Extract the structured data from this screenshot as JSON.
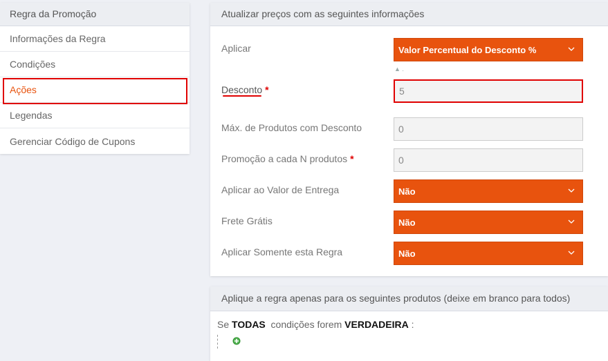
{
  "sidebar": {
    "title": "Regra da Promoção",
    "items": [
      {
        "label": "Informações da Regra",
        "active": false
      },
      {
        "label": "Condições",
        "active": false
      },
      {
        "label": "Ações",
        "active": true
      },
      {
        "label": "Legendas",
        "active": false
      },
      {
        "label": "Gerenciar Código de Cupons",
        "active": false
      }
    ]
  },
  "main": {
    "title": "Atualizar preços com as seguintes informações",
    "fields": {
      "aplicar": {
        "label": "Aplicar",
        "value": "Valor Percentual do Desconto %",
        "note": "▲ ."
      },
      "desconto": {
        "label": "Desconto",
        "required": "*",
        "value": "5"
      },
      "max_produtos": {
        "label": "Máx. de Produtos com Desconto",
        "value": "0"
      },
      "promocao_n": {
        "label": "Promoção a cada N produtos",
        "required": "*",
        "value": "0"
      },
      "valor_entrega": {
        "label": "Aplicar ao Valor de Entrega",
        "value": "Não"
      },
      "frete_gratis": {
        "label": "Frete Grátis",
        "value": "Não"
      },
      "somente_regra": {
        "label": "Aplicar Somente esta Regra",
        "value": "Não"
      }
    }
  },
  "products": {
    "title": "Aplique a regra apenas para os seguintes produtos (deixe em branco para todos)",
    "condition": {
      "prefix": "Se",
      "aggregator": "TODAS",
      "middle": "condições forem",
      "value": "VERDADEIRA",
      "suffix": ":"
    }
  },
  "colors": {
    "accent": "#e8530e",
    "highlight": "#e00000",
    "add_icon": "#3a9a3a"
  }
}
